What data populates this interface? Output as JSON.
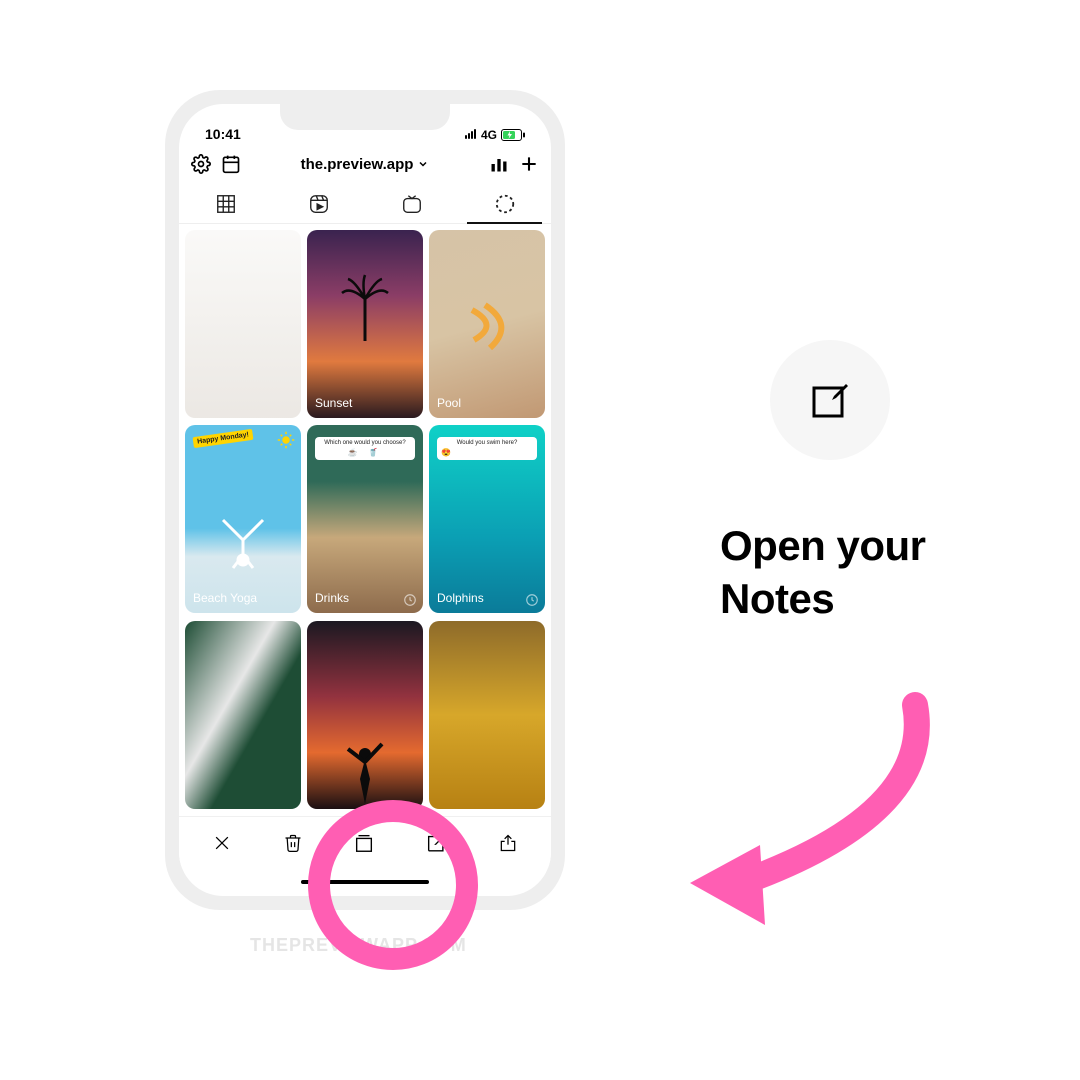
{
  "status": {
    "time": "10:41",
    "network": "4G"
  },
  "header": {
    "account": "the.preview.app"
  },
  "cards": [
    {
      "label": ""
    },
    {
      "label": "Sunset"
    },
    {
      "label": "Pool"
    },
    {
      "label": "Beach Yoga",
      "badge": "Happy Monday!"
    },
    {
      "label": "Drinks",
      "question": "Which one would you choose?"
    },
    {
      "label": "Dolphins",
      "question": "Would you swim here?"
    },
    {
      "label": ""
    },
    {
      "label": ""
    },
    {
      "label": ""
    }
  ],
  "instruction": {
    "line1": "Open your",
    "line2": "Notes"
  },
  "watermark": "THEPREVIEWAPP.COM",
  "highlight_color": "#ff5eb3"
}
